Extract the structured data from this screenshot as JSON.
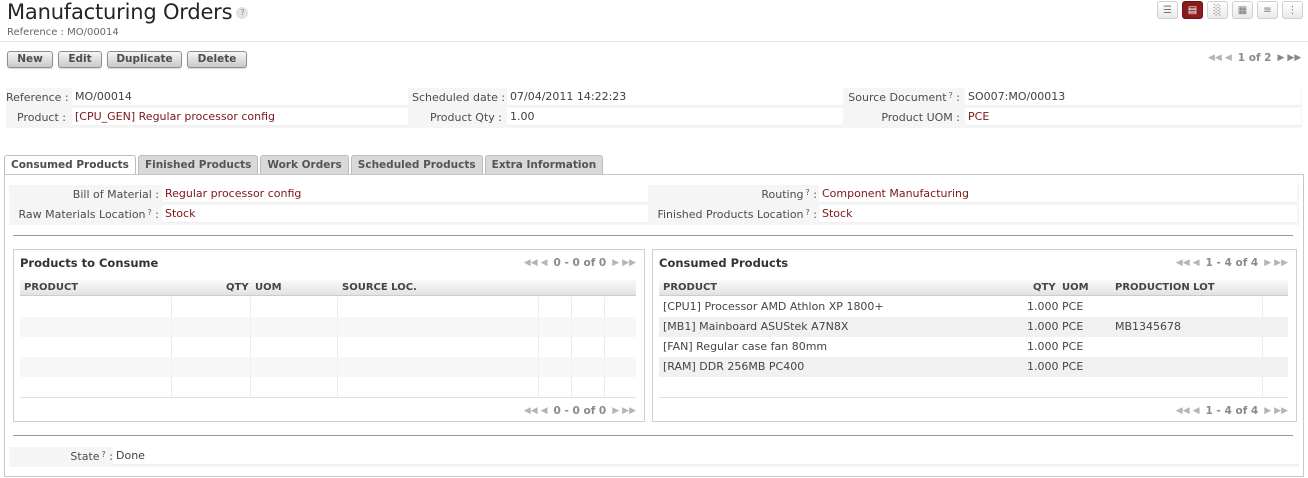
{
  "header": {
    "title": "Manufacturing Orders",
    "help": "?",
    "reference_line": "Reference : MO/00014"
  },
  "toolbar": {
    "new_label": "New",
    "edit_label": "Edit",
    "duplicate_label": "Duplicate",
    "delete_label": "Delete"
  },
  "record_pager": {
    "text": "1 of 2"
  },
  "view_switch": [
    "list-view-icon",
    "form-view-icon",
    "graph-view-icon",
    "calendar-view-icon",
    "gantt-view-icon",
    "kanban-view-icon"
  ],
  "form": {
    "reference_label": "Reference :",
    "reference_value": "MO/00014",
    "product_label": "Product :",
    "product_value": "[CPU_GEN] Regular processor config",
    "scheduled_label": "Scheduled date :",
    "scheduled_value": "07/04/2011 14:22:23",
    "qty_label": "Product Qty :",
    "qty_value": "1.00",
    "source_label": "Source Document",
    "source_value": "SO007:MO/00013",
    "uom_label": "Product UOM :",
    "uom_value": "PCE"
  },
  "tabs": [
    "Consumed Products",
    "Finished Products",
    "Work Orders",
    "Scheduled Products",
    "Extra Information"
  ],
  "consumed_tab": {
    "bom_label": "Bill of Material :",
    "bom_value": "Regular processor config",
    "raw_loc_label": "Raw Materials Location",
    "raw_loc_value": "Stock",
    "routing_label": "Routing",
    "routing_value": "Component Manufacturing",
    "finished_loc_label": "Finished Products Location",
    "finished_loc_value": "Stock",
    "colon": ":",
    "q": "?"
  },
  "to_consume": {
    "title": "Products to Consume",
    "pager": "0 - 0 of 0",
    "columns": [
      "PRODUCT",
      "QTY",
      "UOM",
      "SOURCE LOC."
    ]
  },
  "consumed": {
    "title": "Consumed Products",
    "pager": "1 - 4 of 4",
    "columns": [
      "PRODUCT",
      "QTY",
      "UOM",
      "PRODUCTION LOT"
    ],
    "rows": [
      {
        "product": "[CPU1] Processor AMD Athlon XP 1800+",
        "qty": "1.000",
        "uom": "PCE",
        "lot": ""
      },
      {
        "product": "[MB1] Mainboard ASUStek A7N8X",
        "qty": "1.000",
        "uom": "PCE",
        "lot": "MB1345678"
      },
      {
        "product": "[FAN] Regular case fan 80mm",
        "qty": "1.000",
        "uom": "PCE",
        "lot": ""
      },
      {
        "product": "[RAM] DDR 256MB PC400",
        "qty": "1.000",
        "uom": "PCE",
        "lot": ""
      }
    ]
  },
  "state": {
    "label": "State",
    "value": "Done"
  },
  "colors": {
    "accent": "#8a1c1c",
    "link": "#7c1616",
    "help": "#2a7a2a"
  }
}
